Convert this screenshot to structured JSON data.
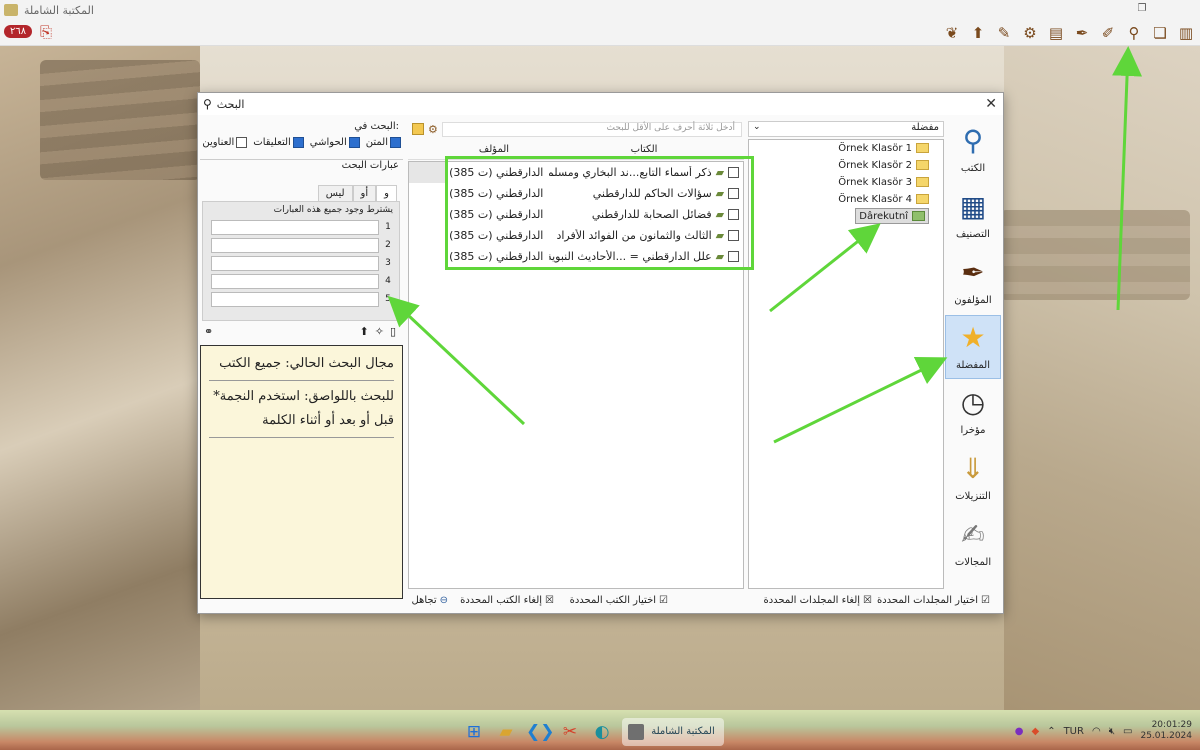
{
  "window": {
    "title": "المكتبة الشاملة",
    "restore_glyph": "❐"
  },
  "toolbar": {
    "badge": "٢٦٨",
    "icons": [
      "leaf-icon",
      "upload-icon",
      "edit-icon",
      "gear-icon",
      "text-icon",
      "feather-icon",
      "notes-icon",
      "search-icon",
      "open-book-icon",
      "book-icon"
    ]
  },
  "dialog": {
    "title": "البحث",
    "close": "✕",
    "left": {
      "search_in_label": "البحث في:",
      "checks": [
        {
          "label": "المتن",
          "checked": true
        },
        {
          "label": "الحواشي",
          "checked": true
        },
        {
          "label": "التعليقات",
          "checked": true
        },
        {
          "label": "العناوين",
          "checked": false
        }
      ],
      "phrases_label": "عبارات البحث",
      "tabs": [
        "و",
        "أو",
        "ليس"
      ],
      "condition_note": "يشترط وجود جميع هذه العبارات",
      "phrase_rows": [
        "1",
        "2",
        "3",
        "4",
        "5"
      ],
      "info": {
        "scope": "مجال البحث الحالي: جميع الكتب",
        "hint": "للبحث باللواصق: استخدم النجمة* قبل أو بعد أو أثناء الكلمة"
      }
    },
    "mid": {
      "search_placeholder": "أدخل ثلاثة أحرف على الأقل للبحث",
      "col_book": "الكتاب",
      "col_author": "المؤلف",
      "rows": [
        {
          "title": "ذكر أسماء التابع...ند البخاري ومسلم",
          "author": "الدارقطني (ت 385)"
        },
        {
          "title": "سؤالات الحاكم للدارقطني",
          "author": "الدارقطني (ت 385)"
        },
        {
          "title": "فضائل الصحابة للدارقطني",
          "author": "الدارقطني (ت 385)"
        },
        {
          "title": "الثالث والثمانون من الفوائد الأفراد",
          "author": "الدارقطني (ت 385)"
        },
        {
          "title": "علل الدارقطني = ...الأحاديث النبوية",
          "author": "الدارقطني (ت 385)"
        }
      ]
    },
    "right": {
      "combo": "مفضلة",
      "folders": [
        "Örnek Klasör 1",
        "Örnek Klasör 2",
        "Örnek Klasör 3",
        "Örnek Klasör 4",
        "Dârekutnî"
      ]
    },
    "sidebar": [
      {
        "label": "الكتب",
        "icon": "books-icon"
      },
      {
        "label": "التصنيف",
        "icon": "category-icon"
      },
      {
        "label": "المؤلفون",
        "icon": "quill-icon"
      },
      {
        "label": "المفضلة",
        "icon": "star-icon"
      },
      {
        "label": "مؤخرا",
        "icon": "clock-icon"
      },
      {
        "label": "التنزيلات",
        "icon": "download-icon"
      },
      {
        "label": "المجالات",
        "icon": "papers-icon"
      }
    ],
    "bottom": {
      "select_folders": "اختيار المجلدات المحددة",
      "cancel_folders": "إلغاء المجلدات المحددة",
      "select_books": "اختيار الكتب المحددة",
      "cancel_books": "إلغاء الكتب المحددة",
      "ignore": "تجاهل"
    }
  },
  "taskbar": {
    "active_app": "المكتبة الشاملة",
    "lang": "TUR",
    "time": "20:01:29",
    "date": "25.01.2024"
  },
  "colors": {
    "highlight": "#5fd63a",
    "arrows": "#5fd63a",
    "badge": "#b3262b"
  }
}
